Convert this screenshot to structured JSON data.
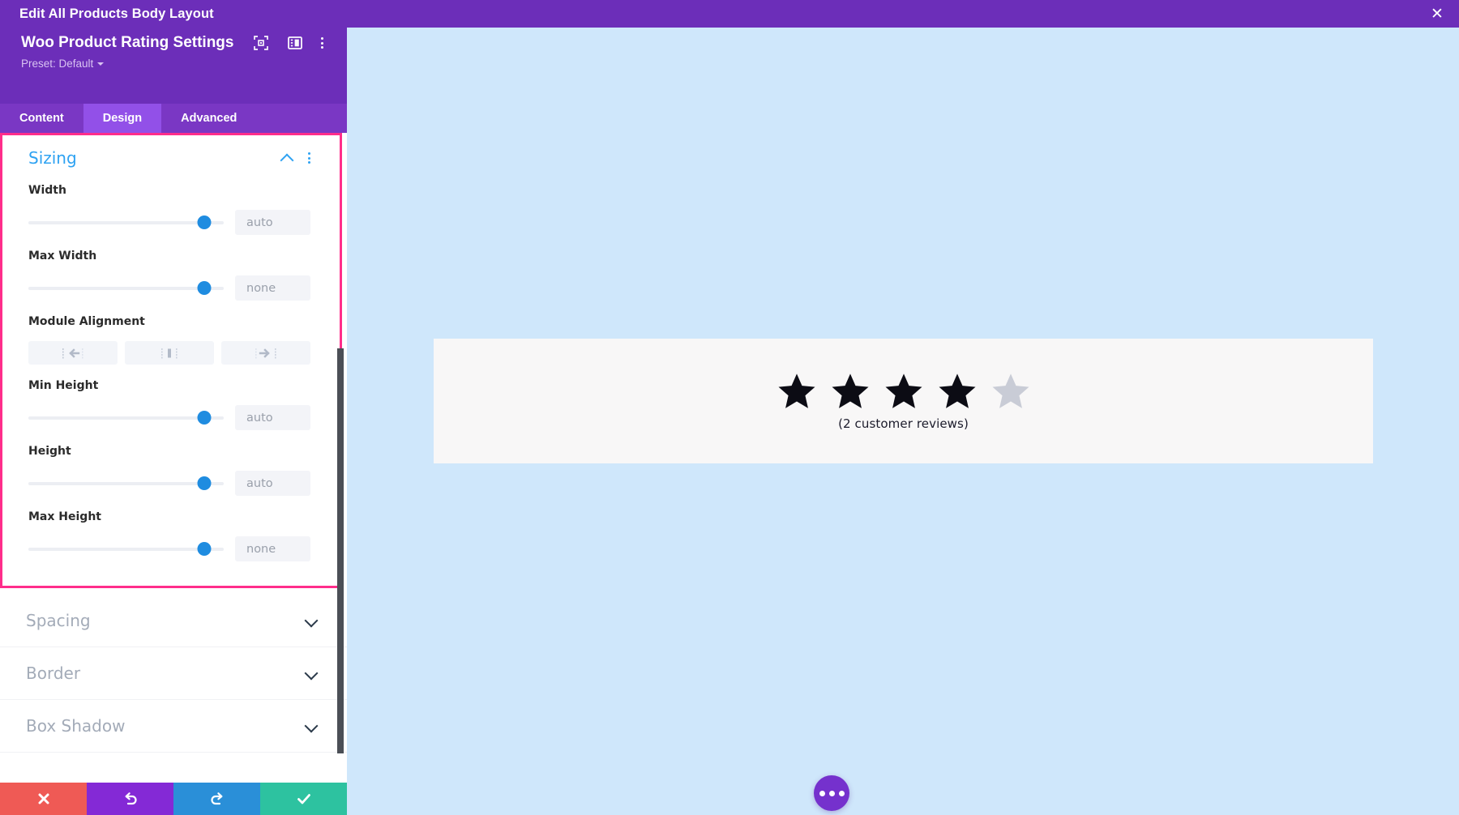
{
  "topbar": {
    "title": "Edit All Products Body Layout",
    "close_icon": "close-icon"
  },
  "panel": {
    "module_title": "Woo Product Rating Settings",
    "preset_label": "Preset: Default",
    "header_icons": [
      {
        "name": "focus-target-icon"
      },
      {
        "name": "layout-panel-icon"
      },
      {
        "name": "more-options-icon"
      }
    ],
    "tabs": [
      {
        "label": "Content",
        "active": false
      },
      {
        "label": "Design",
        "active": true
      },
      {
        "label": "Advanced",
        "active": false
      }
    ],
    "sizing": {
      "title": "Sizing",
      "collapse_icon": "chevron-up-icon",
      "options_icon": "more-options-icon",
      "fields": [
        {
          "label": "Width",
          "value": "auto",
          "type": "slider",
          "knob_percent": 90
        },
        {
          "label": "Max Width",
          "value": "none",
          "type": "slider",
          "knob_percent": 90
        },
        {
          "label": "Module Alignment",
          "type": "align",
          "options": [
            {
              "name": "align-left-icon"
            },
            {
              "name": "align-center-icon"
            },
            {
              "name": "align-right-icon"
            }
          ]
        },
        {
          "label": "Min Height",
          "value": "auto",
          "type": "slider",
          "knob_percent": 90
        },
        {
          "label": "Height",
          "value": "auto",
          "type": "slider",
          "knob_percent": 90
        },
        {
          "label": "Max Height",
          "value": "none",
          "type": "slider",
          "knob_percent": 90
        }
      ]
    },
    "collapsed_sections": [
      {
        "label": "Spacing",
        "icon": "chevron-down-icon"
      },
      {
        "label": "Border",
        "icon": "chevron-down-icon"
      },
      {
        "label": "Box Shadow",
        "icon": "chevron-down-icon"
      }
    ],
    "actions": [
      {
        "name": "cancel-button",
        "icon": "close-icon"
      },
      {
        "name": "undo-button",
        "icon": "undo-icon"
      },
      {
        "name": "redo-button",
        "icon": "redo-icon"
      },
      {
        "name": "save-button",
        "icon": "check-icon"
      }
    ]
  },
  "preview": {
    "rating_filled": 4,
    "rating_total": 5,
    "reviews_text": "(2 customer reviews)",
    "fab_icon": "more-options-icon"
  },
  "colors": {
    "brand_purple": "#6c2eb9",
    "tab_active": "#9250e8",
    "highlight_pink": "#ff2d8b",
    "accent_blue": "#2ea2f2",
    "slider_blue": "#1f8ce0",
    "canvas_blue": "#cfe7fb",
    "card_bg": "#f8f7f7",
    "star_filled": "#0c0c14",
    "star_empty": "#c9ccd6"
  }
}
